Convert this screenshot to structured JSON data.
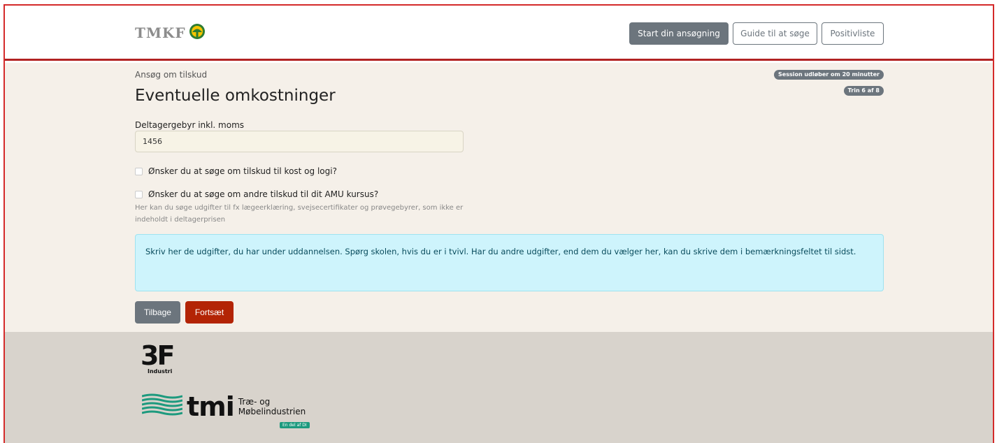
{
  "header": {
    "logo_text": "TMKF",
    "nav": {
      "start": "Start din ansøgning",
      "guide": "Guide til at søge",
      "positiv": "Positivliste"
    }
  },
  "main": {
    "subtitle": "Ansøg om tilskud",
    "title": "Eventuelle omkostninger",
    "session_badge": "Session udløber om 20 minutter",
    "step_badge": "Trin 6 af 8",
    "fee_label": "Deltagergebyr inkl. moms",
    "fee_value": "1456",
    "check_kost": "Ønsker du at søge om tilskud til kost og logi?",
    "check_andre": "Ønsker du at søge om andre tilskud til dit AMU kursus?",
    "help_text": "Her kan du søge udgifter til fx lægeerklæring, svejsecertifikater og prøvegebyrer, som ikke er indeholdt i deltagerprisen",
    "alert_text": "Skriv her de udgifter, du har under uddannelsen. Spørg skolen, hvis du er i tvivl. Har du andre udgifter, end dem du vælger her, kan du skrive dem i bemærkningsfeltet til sidst.",
    "back_label": "Tilbage",
    "next_label": "Fortsæt"
  },
  "footer": {
    "logo_3f": "3F",
    "logo_3f_sub": "Industri",
    "tmi_word": "tmi",
    "tmi_line1": "Træ- og",
    "tmi_line2": "Møbelindustrien",
    "tmi_tag": "En del af DI"
  },
  "colors": {
    "accent_red": "#b32405",
    "secondary": "#6c757d",
    "alert_bg": "#cef4fc",
    "page_bg": "#f5f0e9",
    "footer_bg": "#d8d3cc"
  }
}
